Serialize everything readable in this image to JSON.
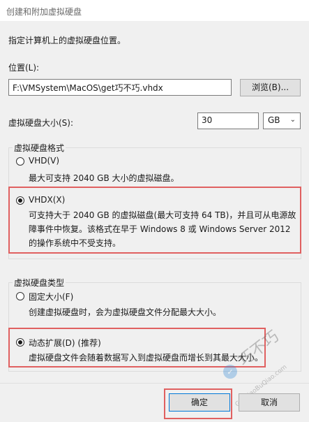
{
  "window": {
    "title": "创建和附加虚拟硬盘"
  },
  "intro": "指定计算机上的虚拟硬盘位置。",
  "location": {
    "label": "位置(L):",
    "value": "F:\\VMSystem\\MacOS\\get巧不巧.vhdx",
    "browse_label": "浏览(B)..."
  },
  "size": {
    "label": "虚拟硬盘大小(S):",
    "value": "30",
    "unit": "GB"
  },
  "format": {
    "legend": "虚拟硬盘格式",
    "options": [
      {
        "label": "VHD(V)",
        "selected": false,
        "desc": [
          "最大可支持 2040 GB 大小的虚拟磁盘。"
        ]
      },
      {
        "label": "VHDX(X)",
        "selected": true,
        "desc": [
          "可支持大于 2040 GB 的虚拟磁盘(最大可支持 64 TB)，并且可从电源故",
          "障事件中恢复。该格式在早于 Windows 8 或 Windows Server 2012",
          "的操作系统中不受支持。"
        ]
      }
    ]
  },
  "type": {
    "legend": "虚拟硬盘类型",
    "options": [
      {
        "label": "固定大小(F)",
        "selected": false,
        "desc": [
          "创建虚拟硬盘时，会为虚拟硬盘文件分配最大大小。"
        ]
      },
      {
        "label": "动态扩展(D) (推荐)",
        "selected": true,
        "desc": [
          "虚拟硬盘文件会随着数据写入到虚拟硬盘而增长到其最大大小。"
        ]
      }
    ]
  },
  "buttons": {
    "ok": "确定",
    "cancel": "取消"
  },
  "watermark": {
    "text1": "巧不巧",
    "text2": "GetQiaoBuQiao.com"
  },
  "colors": {
    "highlight": "#e06060",
    "dialog_bg": "#f0f0f0"
  }
}
